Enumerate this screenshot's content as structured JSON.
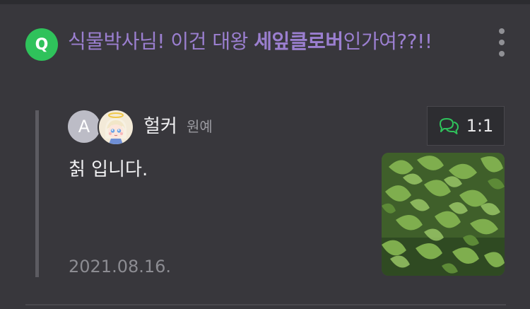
{
  "question": {
    "badge": "Q",
    "title_part1": "식물박사님! 이건 대왕 ",
    "title_strong": "세잎클로버",
    "title_part2": "인가여??!!"
  },
  "answer": {
    "author_avatar_letter": "A",
    "author_name": "헐커",
    "author_tag": "원예",
    "chat_label": "1:1",
    "text": "칡 입니다.",
    "date": "2021.08.16."
  },
  "colors": {
    "background": "#38373c",
    "question_text": "#9b7fd0",
    "q_badge": "#2fc25b",
    "chat_icon": "#2fc25b"
  },
  "icons": {
    "menu": "more-vertical-icon",
    "chat": "chat-bubbles-icon"
  }
}
